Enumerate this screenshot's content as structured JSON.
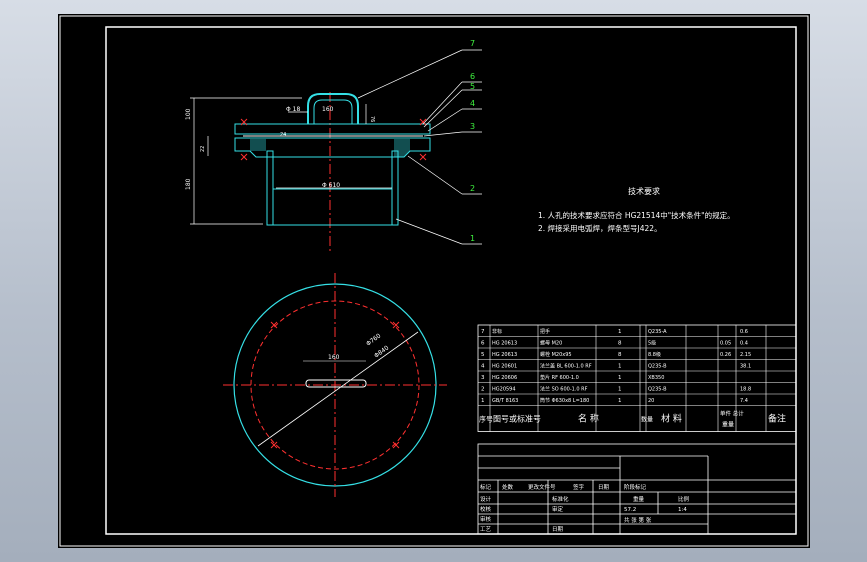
{
  "drawing": {
    "background": "#000000",
    "frame_color": "#ffffff",
    "part_color": "#35e0e6",
    "centerline_color": "#ff3030",
    "balloon_color": "#3ef03e",
    "section": {
      "dim_left_top": "100",
      "dim_left_bottom": "180",
      "dim_left_small": "22",
      "dim_handle_hole": "Φ 18",
      "dim_handle_width": "160",
      "dim_handle_height": "76",
      "dim_flange_thk": "24",
      "dim_bore": "Φ 610",
      "balloons": [
        "7",
        "6",
        "5",
        "4",
        "3",
        "2",
        "1"
      ]
    },
    "plan_view": {
      "dim_handle": "160",
      "dim_bolt_circle": "Φ760",
      "dim_outer": "Φ840"
    },
    "requirements": {
      "title": "技术要求",
      "line1": "1. 人孔的技术要求应符合 HG21514中\"技术条件\"的规定。",
      "line2": "2. 焊接采用电弧焊，焊条型号J422。"
    },
    "bom": {
      "headers": [
        "序号",
        "图号或标准号",
        "名  称",
        "数量",
        "材  料",
        "单件 总计",
        "重量",
        "备注"
      ],
      "rows": [
        {
          "no": "7",
          "code": "非标",
          "name": "把手",
          "qty": "1",
          "mat": "Q235-A",
          "w1": "",
          "w2": "0.6"
        },
        {
          "no": "6",
          "code": "HG 20613",
          "name": "螺母 M20",
          "qty": "8",
          "mat": "5级",
          "w1": "0.05",
          "w2": "0.4"
        },
        {
          "no": "5",
          "code": "HG 20613",
          "name": "螺栓 M20x95",
          "qty": "8",
          "mat": "8.8级",
          "w1": "0.26",
          "w2": "2.15"
        },
        {
          "no": "4",
          "code": "HG 20601",
          "name": "法兰盖 BL 600-1.0 RF",
          "qty": "1",
          "mat": "Q235-B",
          "w1": "",
          "w2": "38.1"
        },
        {
          "no": "3",
          "code": "HG 20606",
          "name": "垫片 RF 600-1.0",
          "qty": "1",
          "mat": "XB350",
          "w1": "",
          "w2": ""
        },
        {
          "no": "2",
          "code": "HG20594",
          "name": "法兰 SO 600-1.0 RF",
          "qty": "1",
          "mat": "Q235-B",
          "w1": "",
          "w2": "18.8"
        },
        {
          "no": "1",
          "code": "GB/T 8163",
          "name": "筒节 Φ630x8 L=180",
          "qty": "1",
          "mat": "20",
          "w1": "",
          "w2": "7.4"
        }
      ]
    },
    "title_block": {
      "r1c1": "标记",
      "r1c2": "处数",
      "r1c3": "更改文件号",
      "r1c4": "签字",
      "r1c5": "日期",
      "r2c1": "设计",
      "r2c2": "标准化",
      "r3c1": "校核",
      "r3c2": "审定",
      "r4c1": "审核",
      "r5c1": "工艺",
      "r5c2": "日期",
      "stage": "阶段标记",
      "weight": "重量",
      "scale": "比例",
      "weight_val": "57.2",
      "scale_val": "1:4",
      "sheets": "共  张  第  张"
    }
  }
}
